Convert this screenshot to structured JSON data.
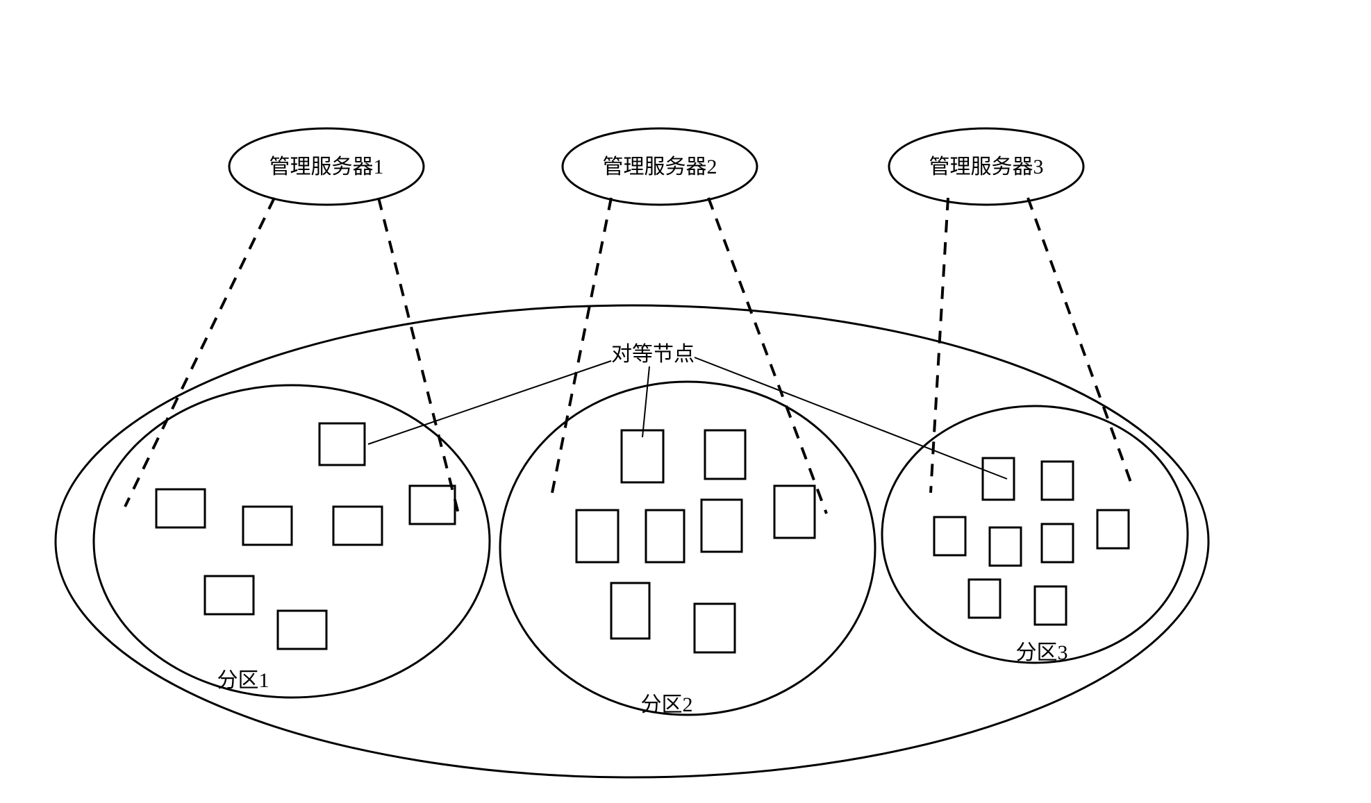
{
  "chart_data": {
    "type": "diagram",
    "description": "Hierarchical P2P network diagram: three management servers at top, each connected by dashed lines to its corresponding partition (zone) within a large overall ellipse. Each zone contains several peer-node rectangles. A floating label '对等节点' (peer node) points to example nodes in zone 1 and zone 2.",
    "title": "",
    "entities": {
      "servers": [
        "管理服务器1",
        "管理服务器2",
        "管理服务器3"
      ],
      "peer_node_label": "对等节点",
      "zones": [
        "分区1",
        "分区2",
        "分区3"
      ],
      "peer_node_counts": {
        "分区1": 7,
        "分区2": 8,
        "分区3": 8
      },
      "connections": [
        {
          "from": "管理服务器1",
          "to": "分区1",
          "style": "dashed"
        },
        {
          "from": "管理服务器2",
          "to": "分区2",
          "style": "dashed"
        },
        {
          "from": "管理服务器3",
          "to": "分区3",
          "style": "dashed"
        }
      ]
    }
  },
  "labels": {
    "server1": "管理服务器1",
    "server2": "管理服务器2",
    "server3": "管理服务器3",
    "peer_node": "对等节点",
    "zone1": "分区1",
    "zone2": "分区2",
    "zone3": "分区3"
  }
}
